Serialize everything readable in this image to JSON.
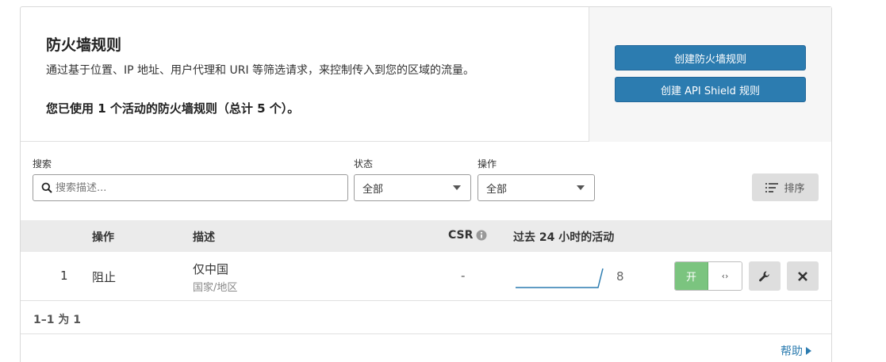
{
  "header": {
    "title": "防火墙规则",
    "description": "通过基于位置、IP 地址、用户代理和 URI 等筛选请求，来控制传入到您的区域的流量。",
    "usage": "您已使用 1 个活动的防火墙规则（总计 5 个）。",
    "create_rule_label": "创建防火墙规则",
    "create_api_shield_label": "创建 API Shield 规则"
  },
  "filters": {
    "search_label": "搜索",
    "search_placeholder": "搜索描述...",
    "status_label": "状态",
    "status_value": "全部",
    "action_label": "操作",
    "action_value": "全部",
    "sort_label": "排序"
  },
  "table": {
    "headers": {
      "action": "操作",
      "description": "描述",
      "csr": "CSR",
      "activity": "过去 24 小时的活动"
    },
    "rows": [
      {
        "index": "1",
        "action": "阻止",
        "description": "仅中国",
        "sub": "国家/地区",
        "csr": "-",
        "activity_count": "8",
        "toggle_on_label": "开"
      }
    ]
  },
  "pagination": {
    "summary": "1–1 为 1"
  },
  "help_label": "帮助",
  "colors": {
    "primary": "#2c7cb0",
    "toggle_on": "#7bc47f",
    "header_bg": "#ebebeb"
  }
}
